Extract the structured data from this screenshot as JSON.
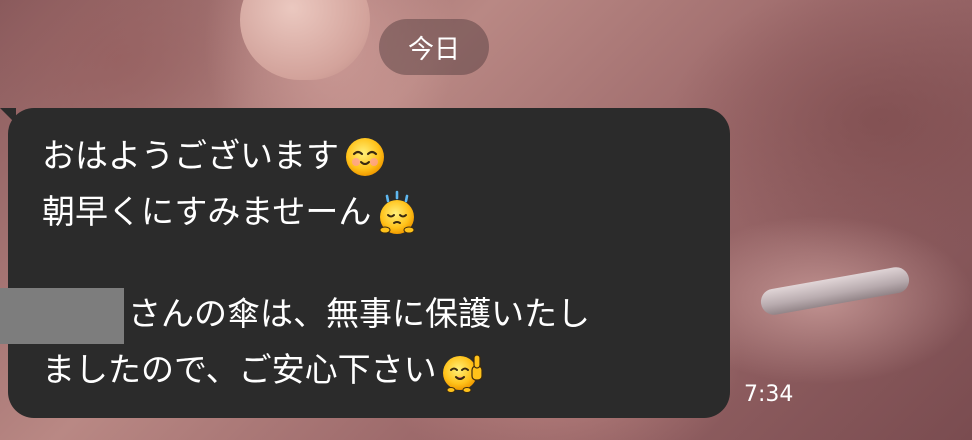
{
  "date_separator": {
    "label": "今日"
  },
  "message": {
    "lines": [
      "おはようございます",
      "朝早くにすみませーん",
      "",
      "さんの傘は、無事に保護いたし",
      "ましたので、ご安心下さい"
    ],
    "emojis": [
      "smiling-face-sticker-icon",
      "sweating-face-sticker-icon",
      "thumbs-up-face-sticker-icon"
    ],
    "bubble_color": "#2b2b2b",
    "text_color": "#ffffff",
    "redaction_color": "#7d7d7d"
  },
  "timestamp": "7:34"
}
